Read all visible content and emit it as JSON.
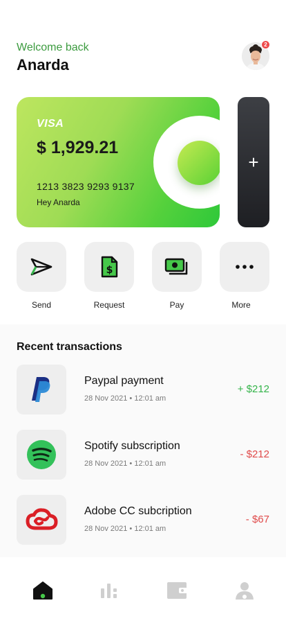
{
  "header": {
    "greeting": "Welcome back",
    "user_name": "Anarda",
    "notification_count": "2"
  },
  "card": {
    "brand": "VISA",
    "balance": "$ 1,929.21",
    "number": "1213 3823 9293 9137",
    "holder": "Hey Anarda",
    "add_label": "+"
  },
  "actions": [
    {
      "label": "Send",
      "icon": "send-icon"
    },
    {
      "label": "Request",
      "icon": "request-icon"
    },
    {
      "label": "Pay",
      "icon": "pay-icon"
    },
    {
      "label": "More",
      "icon": "more-icon"
    }
  ],
  "recent": {
    "title": "Recent transactions",
    "items": [
      {
        "name": "Paypal payment",
        "date": "28 Nov 2021 • 12:01 am",
        "amount": "+ $212",
        "type": "credit",
        "icon": "paypal-icon"
      },
      {
        "name": "Spotify subscription",
        "date": "28 Nov 2021 • 12:01 am",
        "amount": "- $212",
        "type": "debit",
        "icon": "spotify-icon"
      },
      {
        "name": "Adobe CC subcription",
        "date": "28 Nov 2021 • 12:01 am",
        "amount": "- $67",
        "type": "debit",
        "icon": "adobe-cc-icon"
      }
    ]
  },
  "tabs": [
    {
      "name": "home",
      "active": true
    },
    {
      "name": "stats",
      "active": false
    },
    {
      "name": "wallet",
      "active": false
    },
    {
      "name": "profile",
      "active": false
    }
  ],
  "colors": {
    "accent_green": "#3c9b3f",
    "credit": "#34b44a",
    "debit": "#e04b4b",
    "dark": "#1e1f23"
  }
}
